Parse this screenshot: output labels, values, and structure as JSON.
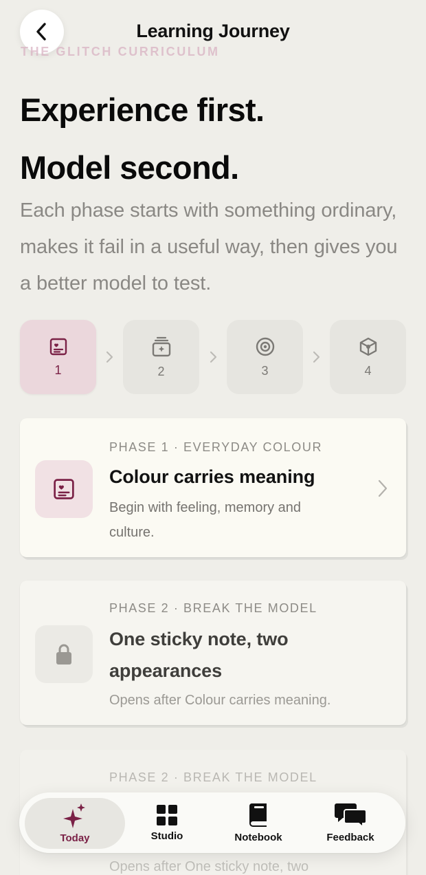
{
  "nav": {
    "title": "Learning Journey",
    "back_icon": "chevron-left-icon"
  },
  "eyebrow": "THE GLITCH CURRICULUM",
  "headline": {
    "line1": "Experience first.",
    "line2": "Model second."
  },
  "lede": "Each phase starts with something ordinary, makes it fail in a useful way, then gives you a better model to test.",
  "steps": [
    {
      "number": "1",
      "icon": "heart-card-icon",
      "active": true
    },
    {
      "number": "2",
      "icon": "sticky-stack-icon",
      "active": false
    },
    {
      "number": "3",
      "icon": "eye-icon",
      "active": false
    },
    {
      "number": "4",
      "icon": "cube-icon",
      "active": false
    }
  ],
  "cards": [
    {
      "phase": "PHASE 1 · EVERYDAY COLOUR",
      "title": "Colour carries meaning",
      "desc": "Begin with feeling, memory and culture.",
      "state": "open",
      "icon": "heart-card-icon"
    },
    {
      "phase": "PHASE 2 · BREAK THE MODEL",
      "title": "One sticky note, two appearances",
      "desc": "Opens after Colour carries meaning.",
      "state": "locked",
      "icon": "lock-icon"
    },
    {
      "phase": "PHASE 2 · BREAK THE MODEL",
      "title": "",
      "desc": "Opens after One sticky note, two",
      "state": "locked",
      "icon": "lock-icon"
    }
  ],
  "tabs": [
    {
      "label": "Today",
      "icon": "sparkle-icon",
      "active": true
    },
    {
      "label": "Studio",
      "icon": "grid-icon",
      "active": false
    },
    {
      "label": "Notebook",
      "icon": "book-icon",
      "active": false
    },
    {
      "label": "Feedback",
      "icon": "chat-bubbles-icon",
      "active": false
    }
  ],
  "colors": {
    "accent": "#7a2146",
    "accent_soft": "#ebd7dc",
    "background": "#efeee9"
  }
}
